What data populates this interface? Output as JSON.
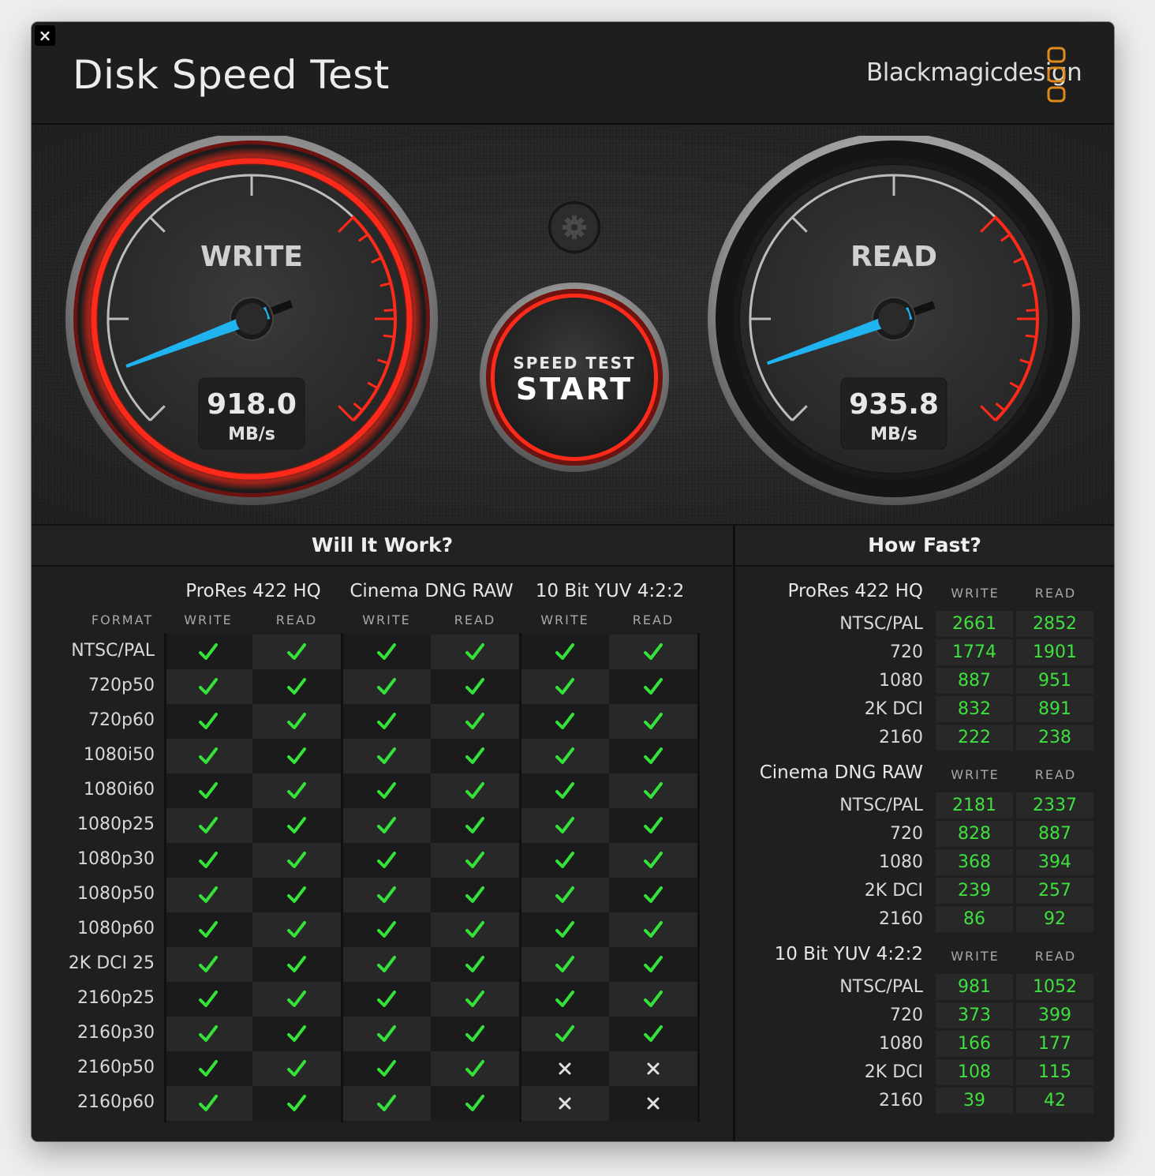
{
  "window": {
    "title": "Disk Speed Test",
    "brand": "Blackmagicdesign",
    "close_label": "×"
  },
  "colors": {
    "accent_red": "#ff2a1a",
    "needle_blue": "#1fb4f0",
    "ok_green": "#34e23a",
    "value_green": "#3ee03e"
  },
  "gauges": {
    "write": {
      "label": "WRITE",
      "value": "918.0",
      "unit": "MB/s",
      "needle_fraction": 0.09
    },
    "read": {
      "label": "READ",
      "value": "935.8",
      "unit": "MB/s",
      "needle_fraction": 0.095
    }
  },
  "start_button": {
    "line1": "SPEED TEST",
    "line2": "START"
  },
  "settings_icon": "gear-icon",
  "will_it_work": {
    "title": "Will It Work?",
    "format_label": "FORMAT",
    "write_label": "WRITE",
    "read_label": "READ",
    "groups": [
      "ProRes 422 HQ",
      "Cinema DNG RAW",
      "10 Bit YUV 4:2:2"
    ],
    "rows": [
      {
        "format": "NTSC/PAL",
        "results": [
          true,
          true,
          true,
          true,
          true,
          true
        ]
      },
      {
        "format": "720p50",
        "results": [
          true,
          true,
          true,
          true,
          true,
          true
        ]
      },
      {
        "format": "720p60",
        "results": [
          true,
          true,
          true,
          true,
          true,
          true
        ]
      },
      {
        "format": "1080i50",
        "results": [
          true,
          true,
          true,
          true,
          true,
          true
        ]
      },
      {
        "format": "1080i60",
        "results": [
          true,
          true,
          true,
          true,
          true,
          true
        ]
      },
      {
        "format": "1080p25",
        "results": [
          true,
          true,
          true,
          true,
          true,
          true
        ]
      },
      {
        "format": "1080p30",
        "results": [
          true,
          true,
          true,
          true,
          true,
          true
        ]
      },
      {
        "format": "1080p50",
        "results": [
          true,
          true,
          true,
          true,
          true,
          true
        ]
      },
      {
        "format": "1080p60",
        "results": [
          true,
          true,
          true,
          true,
          true,
          true
        ]
      },
      {
        "format": "2K DCI 25",
        "results": [
          true,
          true,
          true,
          true,
          true,
          true
        ]
      },
      {
        "format": "2160p25",
        "results": [
          true,
          true,
          true,
          true,
          true,
          true
        ]
      },
      {
        "format": "2160p30",
        "results": [
          true,
          true,
          true,
          true,
          true,
          true
        ]
      },
      {
        "format": "2160p50",
        "results": [
          true,
          true,
          true,
          true,
          false,
          false
        ]
      },
      {
        "format": "2160p60",
        "results": [
          true,
          true,
          true,
          true,
          false,
          false
        ]
      }
    ]
  },
  "how_fast": {
    "title": "How Fast?",
    "write_label": "WRITE",
    "read_label": "READ",
    "groups": [
      {
        "name": "ProRes 422 HQ",
        "rows": [
          {
            "format": "NTSC/PAL",
            "write": "2661",
            "read": "2852"
          },
          {
            "format": "720",
            "write": "1774",
            "read": "1901"
          },
          {
            "format": "1080",
            "write": "887",
            "read": "951"
          },
          {
            "format": "2K DCI",
            "write": "832",
            "read": "891"
          },
          {
            "format": "2160",
            "write": "222",
            "read": "238"
          }
        ]
      },
      {
        "name": "Cinema DNG RAW",
        "rows": [
          {
            "format": "NTSC/PAL",
            "write": "2181",
            "read": "2337"
          },
          {
            "format": "720",
            "write": "828",
            "read": "887"
          },
          {
            "format": "1080",
            "write": "368",
            "read": "394"
          },
          {
            "format": "2K DCI",
            "write": "239",
            "read": "257"
          },
          {
            "format": "2160",
            "write": "86",
            "read": "92"
          }
        ]
      },
      {
        "name": "10 Bit YUV 4:2:2",
        "rows": [
          {
            "format": "NTSC/PAL",
            "write": "981",
            "read": "1052"
          },
          {
            "format": "720",
            "write": "373",
            "read": "399"
          },
          {
            "format": "1080",
            "write": "166",
            "read": "177"
          },
          {
            "format": "2K DCI",
            "write": "108",
            "read": "115"
          },
          {
            "format": "2160",
            "write": "39",
            "read": "42"
          }
        ]
      }
    ]
  }
}
